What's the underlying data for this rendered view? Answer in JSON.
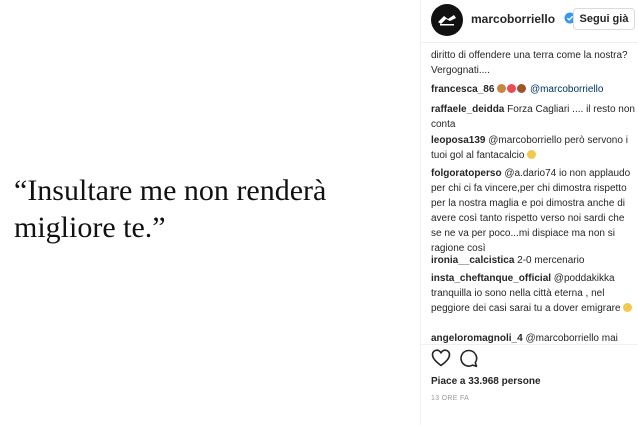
{
  "post": {
    "quote": "“Insultare me non renderà migliore te.”"
  },
  "header": {
    "username": "marcoborriello",
    "follow_label": "Segui già"
  },
  "comments": [
    {
      "user": "",
      "text": "diritto di offendere una terra come la nostra? Vergognati...."
    },
    {
      "user": "francesca_86",
      "text": " @marcoborriello"
    },
    {
      "user": "raffaele_deidda",
      "text": " Forza Cagliari .... il resto non conta"
    },
    {
      "user": "leoposa139",
      "text": " @marcoborriello però servono i tuoi gol al fantacalcio"
    },
    {
      "user": "folgoratoperso",
      "text": " @a.dario74 io non applaudo per chi ci fa vincere,per chi dimostra rispetto per la nostra maglia e poi dimostra anche di avere così tanto rispetto verso noi sardi che se ne va per poco...mi dispiace ma non si ragione così"
    },
    {
      "user": "ironia__calcistica",
      "text": " 2-0 mercenario"
    },
    {
      "user": "insta_cheftanque_official",
      "text": " @poddakikka tranquilla io sono nella città eterna , nel peggiore dei casi sarai tu a dover emigrare"
    },
    {
      "user": "angeloromagnoli_4",
      "text": " @marcoborriello mai"
    }
  ],
  "likes": "Piace a 33.968 persone",
  "time": "13 ORE FA"
}
